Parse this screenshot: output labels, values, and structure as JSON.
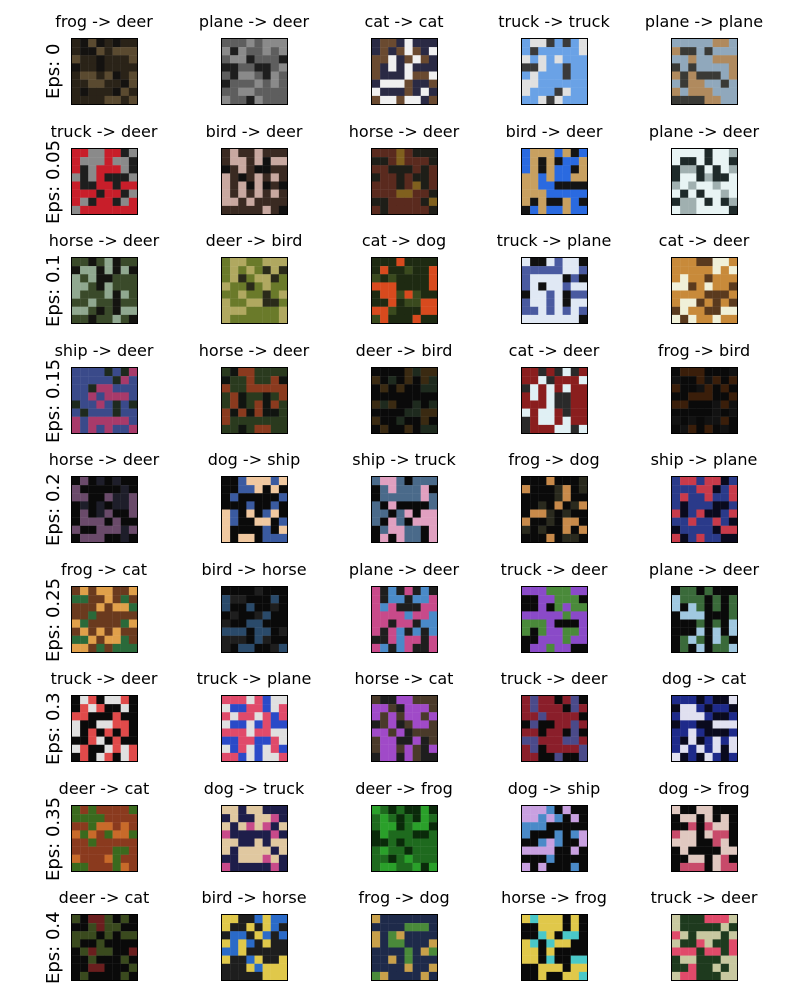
{
  "chart_data": {
    "type": "image_grid",
    "title": "",
    "rows": [
      {
        "label": "Eps: 0",
        "cells": [
          {
            "title": "frog -> deer",
            "colors": [
              "#2a2318",
              "#5a4a30",
              "#141210"
            ]
          },
          {
            "title": "plane -> deer",
            "colors": [
              "#5e5e5e",
              "#8a8a8a",
              "#1e1e1e"
            ]
          },
          {
            "title": "cat -> cat",
            "colors": [
              "#2a2a44",
              "#f0f0f0",
              "#6a4a30"
            ]
          },
          {
            "title": "truck -> truck",
            "colors": [
              "#6aa2e6",
              "#e0e0e0",
              "#3a3a3a"
            ]
          },
          {
            "title": "plane -> plane",
            "colors": [
              "#90a8bc",
              "#b08a5e",
              "#3a3a36"
            ]
          }
        ]
      },
      {
        "label": "Eps: 0.05",
        "cells": [
          {
            "title": "truck -> deer",
            "colors": [
              "#c81e2a",
              "#8a8a8a",
              "#1e1e1e"
            ]
          },
          {
            "title": "bird -> deer",
            "colors": [
              "#3a2a22",
              "#c8a8a0",
              "#101010"
            ]
          },
          {
            "title": "horse -> deer",
            "colors": [
              "#5a2a1e",
              "#1e1e18",
              "#80601e"
            ]
          },
          {
            "title": "bird -> deer",
            "colors": [
              "#2a6ae0",
              "#c8a060",
              "#141414"
            ]
          },
          {
            "title": "plane -> deer",
            "colors": [
              "#e8f4f4",
              "#1e2a2a",
              "#a0b0b0"
            ]
          }
        ]
      },
      {
        "label": "Eps: 0.1",
        "cells": [
          {
            "title": "horse -> deer",
            "colors": [
              "#3a4a2a",
              "#90a890",
              "#141410"
            ]
          },
          {
            "title": "deer -> bird",
            "colors": [
              "#6a7a2a",
              "#b0a860",
              "#2a2a1a"
            ]
          },
          {
            "title": "cat -> dog",
            "colors": [
              "#1e2a12",
              "#d84a1e",
              "#3a4a1e"
            ]
          },
          {
            "title": "truck -> plane",
            "colors": [
              "#e0e8f4",
              "#4a5aa0",
              "#101010"
            ]
          },
          {
            "title": "cat -> deer",
            "colors": [
              "#c88a3a",
              "#f0f0d8",
              "#5a3a1e"
            ]
          }
        ]
      },
      {
        "label": "Eps: 0.15",
        "cells": [
          {
            "title": "ship -> deer",
            "colors": [
              "#3a4a8a",
              "#a83a6a",
              "#1e2a1e"
            ]
          },
          {
            "title": "horse -> deer",
            "colors": [
              "#2a3a1e",
              "#8a3a1e",
              "#101410"
            ]
          },
          {
            "title": "deer -> bird",
            "colors": [
              "#0a0a0a",
              "#3a2a12",
              "#1e2a1e"
            ]
          },
          {
            "title": "cat -> deer",
            "colors": [
              "#8a1e1e",
              "#e0f0f4",
              "#2a2a2a"
            ]
          },
          {
            "title": "frog -> bird",
            "colors": [
              "#0a0a0a",
              "#3a1e0a",
              "#121212"
            ]
          }
        ]
      },
      {
        "label": "Eps: 0.2",
        "cells": [
          {
            "title": "horse -> deer",
            "colors": [
              "#0a0a0a",
              "#6a4a6a",
              "#1e1e2a"
            ]
          },
          {
            "title": "dog -> ship",
            "colors": [
              "#0a0a0a",
              "#f0c8a0",
              "#3a5aa0"
            ]
          },
          {
            "title": "ship -> truck",
            "colors": [
              "#4a6a8a",
              "#e0a0c0",
              "#0a0a0a"
            ]
          },
          {
            "title": "frog -> dog",
            "colors": [
              "#0a0a0a",
              "#c88a4a",
              "#2a2a1e"
            ]
          },
          {
            "title": "ship -> plane",
            "colors": [
              "#2a3a8a",
              "#c83a4a",
              "#0a0a1e"
            ]
          }
        ]
      },
      {
        "label": "Eps: 0.25",
        "cells": [
          {
            "title": "frog -> cat",
            "colors": [
              "#6a3a1e",
              "#e0a04a",
              "#2a6a3a"
            ]
          },
          {
            "title": "bird -> horse",
            "colors": [
              "#0a0a0a",
              "#2a4a6a",
              "#1e1e1e"
            ]
          },
          {
            "title": "plane -> deer",
            "colors": [
              "#c84a8a",
              "#4a8ac8",
              "#1e1e1e"
            ]
          },
          {
            "title": "truck -> deer",
            "colors": [
              "#8a4ac8",
              "#4a8a3a",
              "#0a0a0a"
            ]
          },
          {
            "title": "plane -> deer",
            "colors": [
              "#0a0a0a",
              "#a0c8e0",
              "#3a6a3a"
            ]
          }
        ]
      },
      {
        "label": "Eps: 0.3",
        "cells": [
          {
            "title": "truck -> deer",
            "colors": [
              "#0a0a0a",
              "#e04a4a",
              "#e0e0e0"
            ]
          },
          {
            "title": "truck -> plane",
            "colors": [
              "#e04a6a",
              "#2a4ac8",
              "#e0e0e0"
            ]
          },
          {
            "title": "horse -> cat",
            "colors": [
              "#4a3a2a",
              "#a04ac8",
              "#1e1e1e"
            ]
          },
          {
            "title": "truck -> deer",
            "colors": [
              "#8a1e2a",
              "#4a4a8a",
              "#0a0a0a"
            ]
          },
          {
            "title": "dog -> cat",
            "colors": [
              "#1e2a8a",
              "#e0e0f0",
              "#0a0a1e"
            ]
          }
        ]
      },
      {
        "label": "Eps: 0.35",
        "cells": [
          {
            "title": "deer -> cat",
            "colors": [
              "#8a3a1e",
              "#3a6a1e",
              "#c86a2a"
            ]
          },
          {
            "title": "dog -> truck",
            "colors": [
              "#1e1e4a",
              "#e0c8a0",
              "#c84a8a"
            ]
          },
          {
            "title": "deer -> frog",
            "colors": [
              "#1e6a1e",
              "#2aa02a",
              "#0a2a0a"
            ]
          },
          {
            "title": "dog -> ship",
            "colors": [
              "#0a0a0a",
              "#c8a0e0",
              "#4a8ac8"
            ]
          },
          {
            "title": "dog -> frog",
            "colors": [
              "#0a0a0a",
              "#e0c8c0",
              "#c84a6a"
            ]
          }
        ]
      },
      {
        "label": "Eps: 0.4",
        "cells": [
          {
            "title": "deer -> cat",
            "colors": [
              "#0a0a0a",
              "#3a4a1e",
              "#6a1e1e"
            ]
          },
          {
            "title": "bird -> horse",
            "colors": [
              "#1e1e1e",
              "#e0c84a",
              "#2a6ac8"
            ]
          },
          {
            "title": "frog -> dog",
            "colors": [
              "#1e2a4a",
              "#c8a04a",
              "#4a8a3a"
            ]
          },
          {
            "title": "horse -> frog",
            "colors": [
              "#0a0a0a",
              "#e0c84a",
              "#4ac8c8"
            ]
          },
          {
            "title": "truck -> deer",
            "colors": [
              "#1e3a1e",
              "#c8c8a0",
              "#e04a6a"
            ]
          }
        ]
      }
    ]
  }
}
